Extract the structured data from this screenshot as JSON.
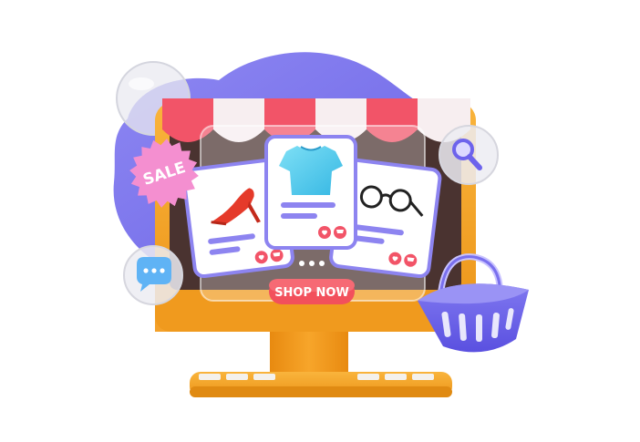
{
  "badge": {
    "text": "SALE",
    "color": "#f48fd0"
  },
  "cta": {
    "label": "SHOP NOW",
    "color": "#f2505c"
  },
  "colors": {
    "blob": "#7b74ea",
    "monitor": "#f6a623",
    "monitor_dark": "#e08a12",
    "screen": "#4a3330",
    "awning_red": "#f25468",
    "awning_white": "#f7eef0",
    "card": "#ffffff",
    "card_border": "#8d84f0",
    "basket": "#6d63ec"
  },
  "products": [
    {
      "name": "shoe",
      "icon": "high-heel-icon"
    },
    {
      "name": "shirt",
      "icon": "tshirt-icon"
    },
    {
      "name": "glasses",
      "icon": "glasses-icon"
    }
  ],
  "icons": [
    "search-icon",
    "chat-bubble-icon",
    "heart-icon",
    "cart-icon",
    "basket-icon",
    "keyboard-icon"
  ]
}
